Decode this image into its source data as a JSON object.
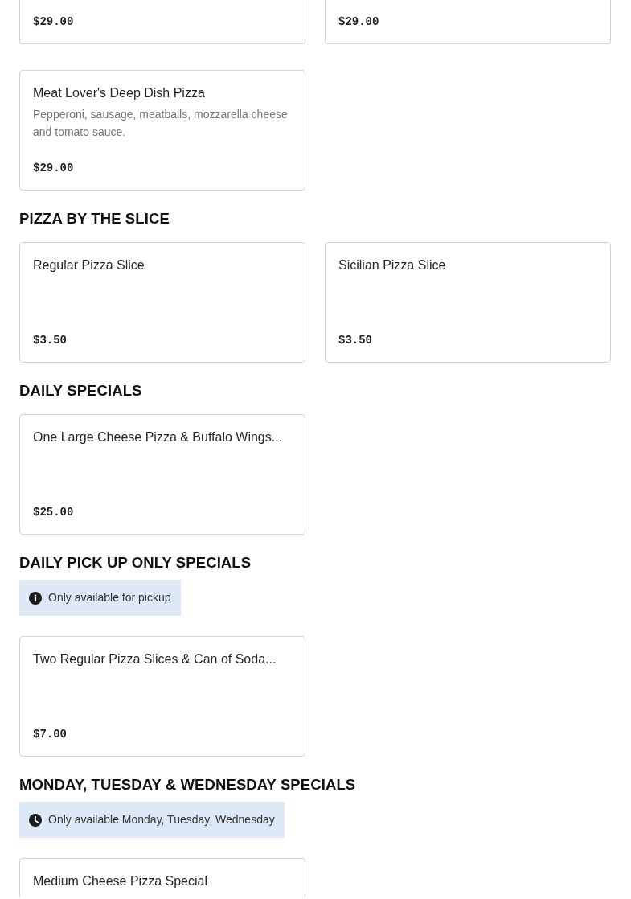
{
  "sections": [
    {
      "items": [
        {
          "top_cut": true,
          "price": "$29.00"
        },
        {
          "top_cut": true,
          "price": "$29.00"
        },
        {
          "top_cut": false,
          "name": "Meat Lover's Deep Dish Pizza",
          "description": "Pepperoni, sausage, meatballs, mozzarella cheese and tomato sauce.",
          "price": "$29.00"
        }
      ]
    },
    {
      "heading": "PIZZA BY THE SLICE",
      "items": [
        {
          "name": "Regular Pizza Slice",
          "price": "$3.50"
        },
        {
          "name": "Sicilian Pizza Slice",
          "price": "$3.50"
        }
      ]
    },
    {
      "heading": "DAILY SPECIALS",
      "items": [
        {
          "name": "One Large Cheese Pizza & Buffalo Wings...",
          "price": "$25.00"
        }
      ]
    },
    {
      "heading": "DAILY PICK UP ONLY SPECIALS",
      "notice": {
        "kind": "info",
        "text": "Only available for pickup"
      },
      "items": [
        {
          "name": "Two Regular Pizza Slices & Can of Soda...",
          "price": "$7.00"
        }
      ]
    },
    {
      "heading": "MONDAY, TUESDAY & WEDNESDAY SPECIALS",
      "notice": {
        "kind": "clock",
        "text": "Only available Monday, Tuesday, Wednesday"
      },
      "items": [
        {
          "bottom_cut": true,
          "name": "Medium Cheese Pizza Special"
        }
      ]
    }
  ]
}
